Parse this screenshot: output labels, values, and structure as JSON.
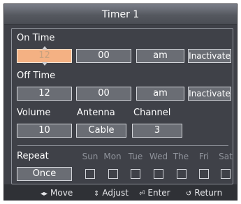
{
  "title": "Timer 1",
  "on_time": {
    "label": "On Time",
    "hour": "12",
    "minute": "00",
    "ampm": "am",
    "status": "Inactivate"
  },
  "off_time": {
    "label": "Off Time",
    "hour": "12",
    "minute": "00",
    "ampm": "am",
    "status": "Inactivate"
  },
  "volume": {
    "label": "Volume",
    "value": "10"
  },
  "antenna": {
    "label": "Antenna",
    "value": "Cable"
  },
  "channel": {
    "label": "Channel",
    "value": "3"
  },
  "repeat": {
    "label": "Repeat",
    "value": "Once",
    "days": [
      "Sun",
      "Mon",
      "Tue",
      "Wed",
      "The",
      "Fri",
      "Sat"
    ]
  },
  "footer": {
    "move": "Move",
    "adjust": "Adjust",
    "enter": "Enter",
    "return": "Return",
    "icons": [
      "left-right-arrows-icon",
      "up-down-arrows-icon",
      "enter-icon",
      "return-icon"
    ]
  },
  "colors": {
    "background": "#3f4148",
    "highlight": "#f4b183",
    "field": "#6a6d74",
    "border": "#d3d5da"
  }
}
